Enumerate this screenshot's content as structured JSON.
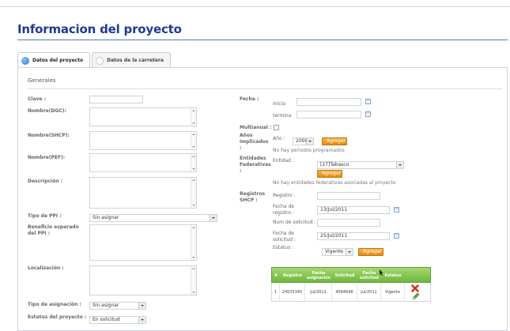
{
  "page": {
    "title": "Informacion del proyecto"
  },
  "tabs": [
    {
      "label": "Datos del proyecto",
      "active": true
    },
    {
      "label": "Datos de la carretera",
      "active": false
    }
  ],
  "section": {
    "label": "Generales"
  },
  "left": {
    "clave_label": "Clave :",
    "nombre_dgc_label": "Nombre(DGC):",
    "nombre_shcp_label": "Nombre(SHCP):",
    "nombre_pef_label": "Nombre(PEF):",
    "descripcion_label": "Descripción :",
    "tipo_ppi_label": "Tipo de PPI :",
    "tipo_ppi_value": "Sin asignar",
    "beneficio_label": "Beneficio esperado del PPI :",
    "localizacion_label": "Localización :",
    "tipo_asignacion_label": "Tipo de asignación :",
    "tipo_asignacion_value": "Sin asignar",
    "estatus_label": "Estatus del proyecto :",
    "estatus_value": "En solicitud"
  },
  "right": {
    "fecha_label": "Fecha :",
    "inicia_label": "Inicia",
    "termina_label": "termina",
    "multianual_label": "Multianual :",
    "anios_label": "Años implicados :",
    "anio_label": "Año :",
    "anio_value": "2008",
    "agregar_label": "Agregar",
    "no_periodos": "No hay periodos programados",
    "entidades_label": "Entidades Federativas :",
    "entidad_label": "Entidad :",
    "entidad_value": "[27]Tabasco",
    "no_entidades": "No hay entidades federativas asociadas al proyecto",
    "registros_label": "Registros SHCP :",
    "registro_label": "Registro :",
    "fecha_registro_label": "Fecha de registro :",
    "fecha_registro_value": "13/Jul/2011",
    "num_solicitud_label": "Num de solicitud :",
    "fecha_solicitud_label": "Fecha de solicitud :",
    "fecha_solicitud_value": "25/Jul/2011",
    "estatus_label": "Estatus :",
    "estatus_value": "Vigente"
  },
  "grid": {
    "headers": [
      "#",
      "Registro",
      "Fecha asignación",
      "Solicitud",
      "Fecha solicitud",
      "Estatus"
    ],
    "rows": [
      [
        "1",
        "24535345",
        "Jul/2011",
        "4564646",
        "Jul/2011",
        "Vigente"
      ]
    ]
  },
  "colors": {
    "title": "#1f3a93",
    "accent_orange": "#e88b0c",
    "grid_green": "#6fb73f"
  }
}
